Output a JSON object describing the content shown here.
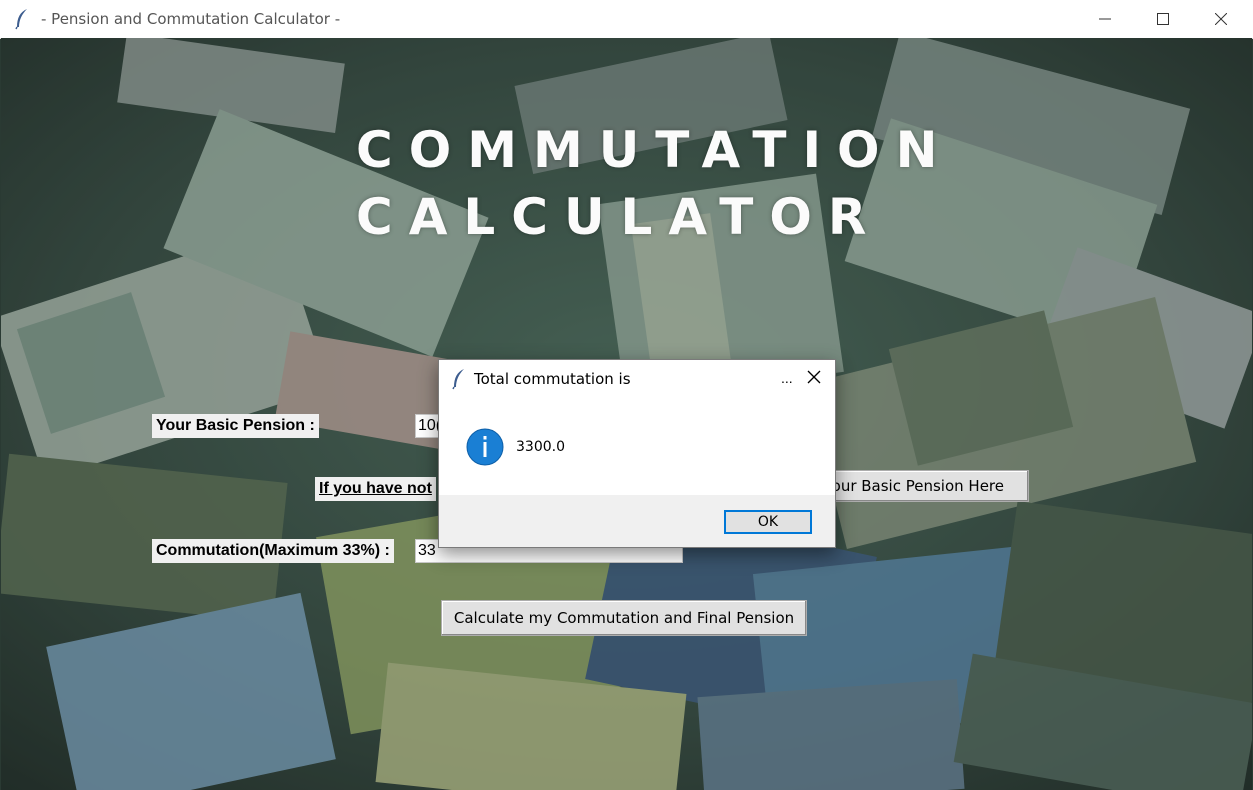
{
  "window": {
    "title": " - Pension and Commutation Calculator -",
    "minimize_icon": "minimize-icon",
    "maximize_icon": "maximize-icon",
    "close_icon": "close-icon",
    "app_icon": "feather-icon"
  },
  "main": {
    "heading_line1": "COMMUTATION",
    "heading_line2": "CALCULATOR",
    "basic_pension_label": "Your Basic Pension :",
    "basic_pension_value": "10(",
    "info_label": "If you have not",
    "calculate_basic_button": "e your Basic Pension Here",
    "commutation_label": "Commutation(Maximum 33%) :",
    "commutation_value": "33",
    "calculate_button": "Calculate my Commutation and Final Pension"
  },
  "dialog": {
    "title": "Total commutation is",
    "more_label": "...",
    "message": "3300.0",
    "icon": "info-icon",
    "ok_label": "OK"
  },
  "colors": {
    "accent": "#0078d7",
    "info_icon": "#1a7fd4",
    "background_tint": "#3b5a4c"
  }
}
